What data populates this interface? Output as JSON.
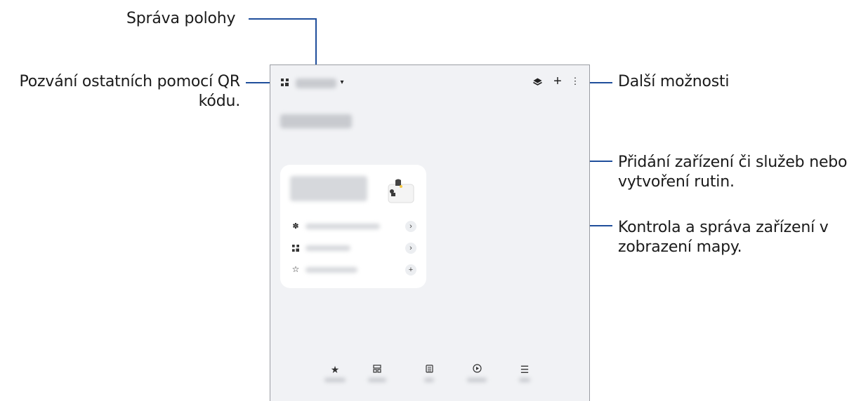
{
  "callouts": {
    "location": "Správa polohy",
    "qr_invite_line1": "Pozvání ostatních pomocí QR",
    "qr_invite_line2": "kódu.",
    "more_options": "Další možnosti",
    "add_line1": "Přidání zařízení či služeb nebo",
    "add_line2": "vytvoření rutin.",
    "map_line1": "Kontrola a správa zařízení v",
    "map_line2": "zobrazení mapy."
  },
  "colors": {
    "callout_line": "#1f4e9b",
    "screen_bg": "#f1f2f5"
  },
  "icons": {
    "qr": "qr-code-icon",
    "dropdown": "caret-down-icon",
    "map": "map-view-icon",
    "add": "plus-icon",
    "more": "more-vertical-icon",
    "device_fan": "fan-icon",
    "device_qr": "qr-code-icon",
    "device_star": "star-icon",
    "chevron": "chevron-right-icon",
    "add_small": "plus-icon",
    "nav": [
      "star-icon",
      "devices-icon",
      "life-icon",
      "routines-icon",
      "menu-icon"
    ]
  },
  "glyphs": {
    "plus": "+",
    "more": "⋮",
    "caret": "▾",
    "chevron": "›",
    "star_filled": "★",
    "star_outline": "☆",
    "menu": "☰"
  }
}
